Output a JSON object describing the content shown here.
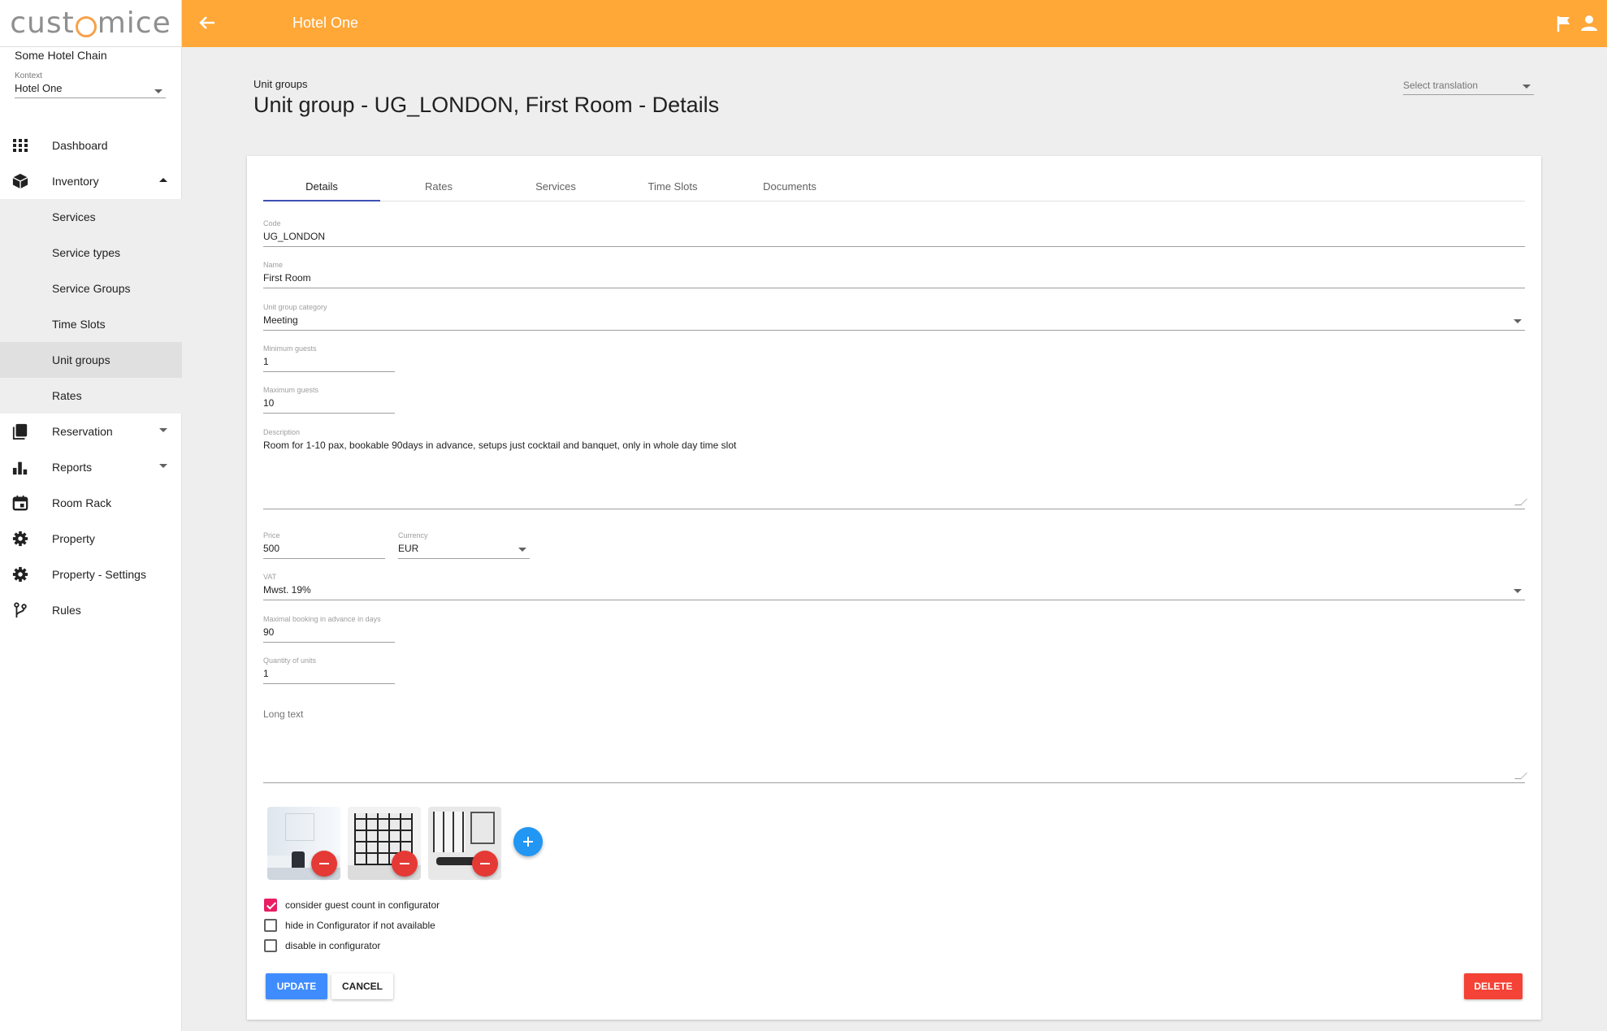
{
  "app": {
    "logo_text_a": "cust",
    "logo_text_b": "mice",
    "chain_name": "Some Hotel Chain",
    "context_label": "Kontext",
    "context_value": "Hotel One"
  },
  "topbar": {
    "title": "Hotel One"
  },
  "sidebar": {
    "items": [
      {
        "label": "Dashboard",
        "icon": "grid-icon"
      },
      {
        "label": "Inventory",
        "icon": "cube-icon"
      },
      {
        "label": "Services"
      },
      {
        "label": "Service types"
      },
      {
        "label": "Service Groups"
      },
      {
        "label": "Time Slots"
      },
      {
        "label": "Unit groups"
      },
      {
        "label": "Rates"
      },
      {
        "label": "Reservation",
        "icon": "book-icon"
      },
      {
        "label": "Reports",
        "icon": "bar-chart-icon"
      },
      {
        "label": "Room Rack",
        "icon": "calendar-icon"
      },
      {
        "label": "Property",
        "icon": "gear-icon"
      },
      {
        "label": "Property - Settings",
        "icon": "gear-icon"
      },
      {
        "label": "Rules",
        "icon": "branch-icon"
      }
    ]
  },
  "header": {
    "breadcrumb": "Unit groups",
    "title": "Unit group - UG_LONDON, First Room - Details",
    "translation_placeholder": "Select translation"
  },
  "tabs": [
    "Details",
    "Rates",
    "Services",
    "Time Slots",
    "Documents"
  ],
  "form": {
    "code": {
      "label": "Code",
      "value": "UG_LONDON"
    },
    "name": {
      "label": "Name",
      "value": "First Room"
    },
    "category": {
      "label": "Unit group category",
      "value": "Meeting"
    },
    "min_guests": {
      "label": "Minimum guests",
      "value": "1"
    },
    "max_guests": {
      "label": "Maximum guests",
      "value": "10"
    },
    "description": {
      "label": "Description",
      "value": "Room for 1-10 pax, bookable 90days in advance, setups just cocktail and banquet, only in whole day time slot"
    },
    "price": {
      "label": "Price",
      "value": "500"
    },
    "currency": {
      "label": "Currency",
      "value": "EUR"
    },
    "vat": {
      "label": "VAT",
      "value": "Mwst. 19%"
    },
    "max_booking": {
      "label": "Maximal booking in advance in days",
      "value": "90"
    },
    "quantity": {
      "label": "Quantity of units",
      "value": "1"
    },
    "long_text": {
      "placeholder": "Long text"
    }
  },
  "checkboxes": [
    {
      "label": "consider guest count in configurator",
      "checked": true
    },
    {
      "label": "hide in Configurator if not available",
      "checked": false
    },
    {
      "label": "disable in configurator",
      "checked": false
    }
  ],
  "buttons": {
    "update": "UPDATE",
    "cancel": "CANCEL",
    "delete": "DELETE"
  },
  "colors": {
    "topbar": "#ffa737",
    "primary": "#3f8cff",
    "danger": "#f44336",
    "check": "#e91e63",
    "add": "#2196f3"
  }
}
